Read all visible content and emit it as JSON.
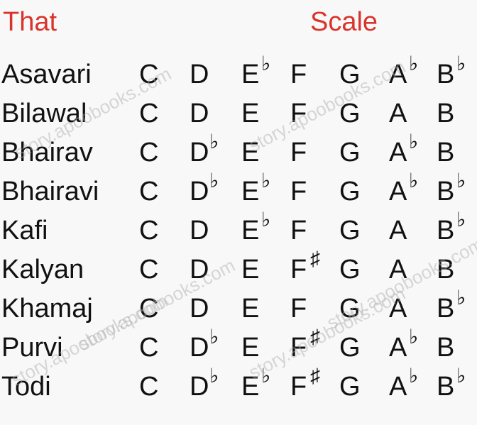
{
  "headers": {
    "that": "That",
    "scale": "Scale"
  },
  "flat_symbol": "♭",
  "sharp_symbol": "♯",
  "rows": [
    {
      "name": "Asavari",
      "notes": [
        [
          "C",
          ""
        ],
        [
          "D",
          ""
        ],
        [
          "E",
          "flat"
        ],
        [
          "F",
          ""
        ],
        [
          "G",
          ""
        ],
        [
          "A",
          "flat"
        ],
        [
          "B",
          "flat"
        ]
      ]
    },
    {
      "name": "Bilawal",
      "notes": [
        [
          "C",
          ""
        ],
        [
          "D",
          ""
        ],
        [
          "E",
          ""
        ],
        [
          "F",
          ""
        ],
        [
          "G",
          ""
        ],
        [
          "A",
          ""
        ],
        [
          "B",
          ""
        ]
      ]
    },
    {
      "name": "Bhairav",
      "notes": [
        [
          "C",
          ""
        ],
        [
          "D",
          "flat"
        ],
        [
          "E",
          ""
        ],
        [
          "F",
          ""
        ],
        [
          "G",
          ""
        ],
        [
          "A",
          "flat"
        ],
        [
          "B",
          ""
        ]
      ]
    },
    {
      "name": "Bhairavi",
      "notes": [
        [
          "C",
          ""
        ],
        [
          "D",
          "flat"
        ],
        [
          "E",
          "flat"
        ],
        [
          "F",
          ""
        ],
        [
          "G",
          ""
        ],
        [
          "A",
          "flat"
        ],
        [
          "B",
          "flat"
        ]
      ]
    },
    {
      "name": "Kafi",
      "notes": [
        [
          "C",
          ""
        ],
        [
          "D",
          ""
        ],
        [
          "E",
          "flat"
        ],
        [
          "F",
          ""
        ],
        [
          "G",
          ""
        ],
        [
          "A",
          ""
        ],
        [
          "B",
          "flat"
        ]
      ]
    },
    {
      "name": "Kalyan",
      "notes": [
        [
          "C",
          ""
        ],
        [
          "D",
          ""
        ],
        [
          "E",
          ""
        ],
        [
          "F",
          "sharp"
        ],
        [
          "G",
          ""
        ],
        [
          "A",
          ""
        ],
        [
          "B",
          ""
        ]
      ]
    },
    {
      "name": "Khamaj",
      "notes": [
        [
          "C",
          ""
        ],
        [
          "D",
          ""
        ],
        [
          "E",
          ""
        ],
        [
          "F",
          ""
        ],
        [
          "G",
          ""
        ],
        [
          "A",
          ""
        ],
        [
          "B",
          "flat"
        ]
      ]
    },
    {
      "name": "Purvi",
      "notes": [
        [
          "C",
          ""
        ],
        [
          "D",
          "flat"
        ],
        [
          "E",
          ""
        ],
        [
          "F",
          "sharp"
        ],
        [
          "G",
          ""
        ],
        [
          "A",
          "flat"
        ],
        [
          "B",
          ""
        ]
      ]
    },
    {
      "name": "Todi",
      "notes": [
        [
          "C",
          ""
        ],
        [
          "D",
          "flat"
        ],
        [
          "E",
          "flat"
        ],
        [
          "F",
          "sharp"
        ],
        [
          "G",
          ""
        ],
        [
          "A",
          "flat"
        ],
        [
          "B",
          "flat"
        ]
      ]
    }
  ],
  "watermark": "story.apoobooks.com"
}
